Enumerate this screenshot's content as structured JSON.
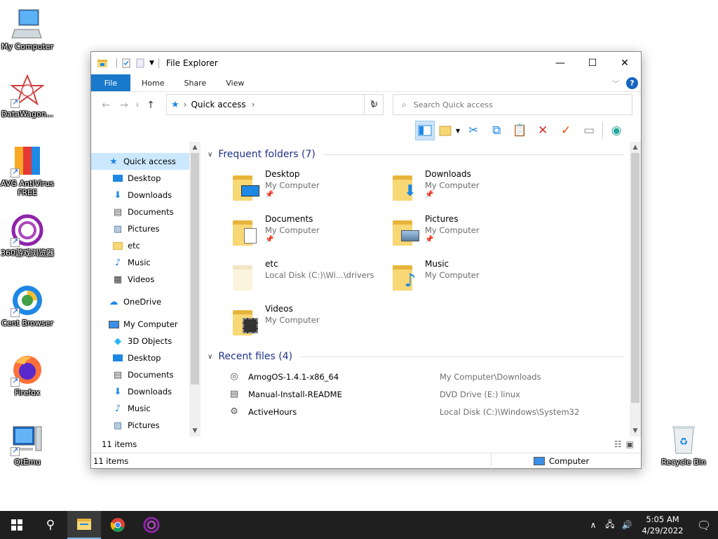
{
  "desktop": {
    "icons": [
      {
        "label": "My Computer"
      },
      {
        "label": "DataWagon..."
      },
      {
        "label": "AVG AntiVirus FREE"
      },
      {
        "label": "360游戏浏览器"
      },
      {
        "label": "Cent Browser"
      },
      {
        "label": "Firefox"
      },
      {
        "label": "QtEmu"
      },
      {
        "label": "Recycle Bin"
      }
    ]
  },
  "window": {
    "title": "File Explorer",
    "controls": {
      "minimize": "—",
      "maximize": "☐",
      "close": "✕"
    },
    "ribbon_tabs": [
      "File",
      "Home",
      "Share",
      "View"
    ],
    "address": {
      "location": "Quick access",
      "chevron": "›"
    },
    "search": {
      "placeholder": "Search Quick access"
    },
    "nav": {
      "quick_access": "Quick access",
      "pinned": [
        "Desktop",
        "Downloads",
        "Documents",
        "Pictures"
      ],
      "unpinned": [
        "etc",
        "Music",
        "Videos"
      ],
      "onedrive": "OneDrive",
      "my_computer": "My Computer",
      "computer_children": [
        "3D Objects",
        "Desktop",
        "Documents",
        "Downloads",
        "Music",
        "Pictures"
      ]
    },
    "frequent": {
      "header": "Frequent folders (7)",
      "items": [
        {
          "name": "Desktop",
          "location": "My Computer",
          "pinned": true
        },
        {
          "name": "Downloads",
          "location": "My Computer",
          "pinned": true
        },
        {
          "name": "Documents",
          "location": "My Computer",
          "pinned": true
        },
        {
          "name": "Pictures",
          "location": "My Computer",
          "pinned": true
        },
        {
          "name": "etc",
          "location": "Local Disk (C:)\\Wi...\\drivers",
          "pinned": false
        },
        {
          "name": "Music",
          "location": "My Computer",
          "pinned": false
        },
        {
          "name": "Videos",
          "location": "My Computer",
          "pinned": false
        }
      ]
    },
    "recent": {
      "header": "Recent files (4)",
      "items": [
        {
          "name": "AmogOS-1.4.1-x86_64",
          "path": "My Computer\\Downloads"
        },
        {
          "name": "Manual-Install-README",
          "path": "DVD Drive (E:) linux"
        },
        {
          "name": "ActiveHours",
          "path": "Local Disk (C:)\\Windows\\System32"
        }
      ]
    },
    "inner_status": "11 items",
    "status": {
      "count": "11 items",
      "location": "Computer"
    }
  },
  "taskbar": {
    "time": "5:05 AM",
    "date": "4/29/2022"
  },
  "colors": {
    "accent": "#1979ca",
    "header_text": "#1e3287",
    "selection": "#cce8ff",
    "taskbar": "#1f1f1f"
  }
}
